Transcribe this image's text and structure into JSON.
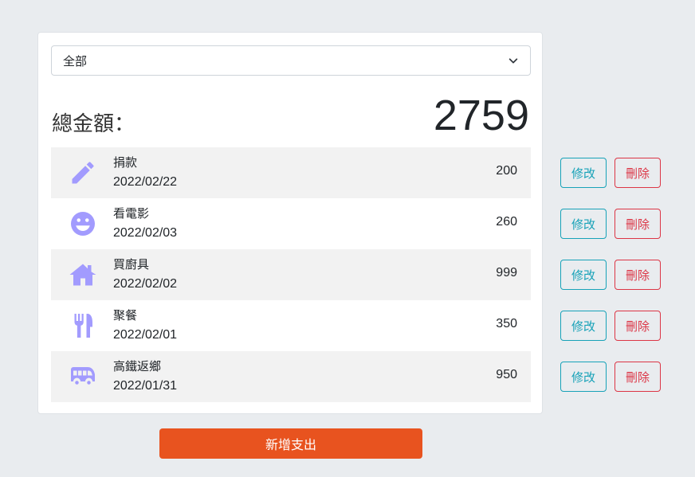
{
  "filter": {
    "selected": "全部"
  },
  "summary": {
    "label": "總金額：",
    "total": "2759"
  },
  "expenses": [
    {
      "name": "捐款",
      "date": "2022/02/22",
      "amount": "200",
      "icon": "pencil-icon"
    },
    {
      "name": "看電影",
      "date": "2022/02/03",
      "amount": "260",
      "icon": "smile-icon"
    },
    {
      "name": "買廚具",
      "date": "2022/02/02",
      "amount": "999",
      "icon": "home-icon"
    },
    {
      "name": "聚餐",
      "date": "2022/02/01",
      "amount": "350",
      "icon": "utensils-icon"
    },
    {
      "name": "高鐵返鄉",
      "date": "2022/01/31",
      "amount": "950",
      "icon": "bus-icon"
    }
  ],
  "actions": {
    "edit_label": "修改",
    "delete_label": "刪除"
  },
  "add_button": {
    "label": "新增支出"
  },
  "colors": {
    "icon": "#a29bfe",
    "edit": "#17a2b8",
    "delete": "#dc3545",
    "add": "#e8531f"
  }
}
